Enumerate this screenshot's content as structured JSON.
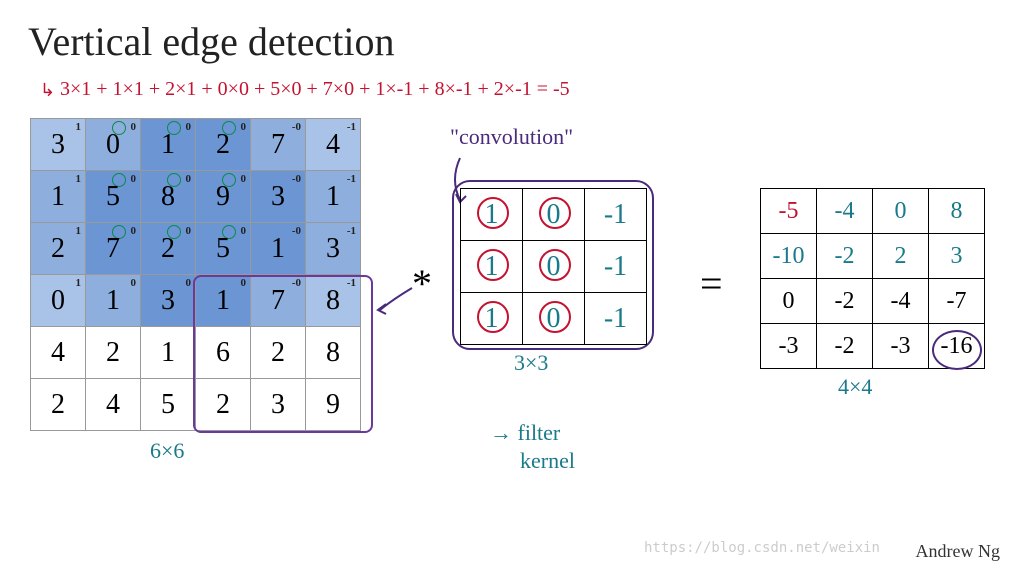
{
  "title": "Vertical edge detection",
  "equation": "3×1 + 1×1 + 2×1 + 0×0 + 5×0 + 7×0 + 1×-1 + 8×-1 + 2×-1 = -5",
  "input": {
    "rows": [
      [
        3,
        0,
        1,
        2,
        7,
        4
      ],
      [
        1,
        5,
        8,
        9,
        3,
        1
      ],
      [
        2,
        7,
        2,
        5,
        1,
        3
      ],
      [
        0,
        1,
        3,
        1,
        7,
        8
      ],
      [
        4,
        2,
        1,
        6,
        2,
        8
      ],
      [
        2,
        4,
        5,
        2,
        3,
        9
      ]
    ],
    "sup_row": [
      "1",
      "0",
      "0",
      "0",
      "-0",
      "-1"
    ],
    "label": "6×6"
  },
  "filter": {
    "rows": [
      [
        1,
        0,
        -1
      ],
      [
        1,
        0,
        -1
      ],
      [
        1,
        0,
        -1
      ]
    ],
    "label": "3×3",
    "annot_conv": "\"convolution\"",
    "annot_filter": "→ filter",
    "annot_kernel": "kernel"
  },
  "op_conv": "*",
  "op_eq": "=",
  "output": {
    "rows": [
      [
        "-5",
        "-4",
        "0",
        "8"
      ],
      [
        "-10",
        "-2",
        "2",
        "3"
      ],
      [
        "0",
        "-2",
        "-4",
        "-7"
      ],
      [
        "-3",
        "-2",
        "-3",
        "-16"
      ]
    ],
    "label": "4×4"
  },
  "attribution": "Andrew Ng",
  "watermark": "https://blog.csdn.net/weixin",
  "chart_data": {
    "type": "table",
    "description": "Convolution of a 6x6 input with a 3x3 vertical-edge filter producing a 4x4 output",
    "input_matrix": [
      [
        3,
        0,
        1,
        2,
        7,
        4
      ],
      [
        1,
        5,
        8,
        9,
        3,
        1
      ],
      [
        2,
        7,
        2,
        5,
        1,
        3
      ],
      [
        0,
        1,
        3,
        1,
        7,
        8
      ],
      [
        4,
        2,
        1,
        6,
        2,
        8
      ],
      [
        2,
        4,
        5,
        2,
        3,
        9
      ]
    ],
    "filter": [
      [
        1,
        0,
        -1
      ],
      [
        1,
        0,
        -1
      ],
      [
        1,
        0,
        -1
      ]
    ],
    "output_matrix": [
      [
        -5,
        -4,
        0,
        8
      ],
      [
        -10,
        -2,
        2,
        3
      ],
      [
        0,
        -2,
        -4,
        -7
      ],
      [
        -3,
        -2,
        -3,
        -16
      ]
    ],
    "worked_example": "3*1 + 1*1 + 2*1 + 0*0 + 5*0 + 7*0 + 1*-1 + 8*-1 + 2*-1 = -5"
  }
}
